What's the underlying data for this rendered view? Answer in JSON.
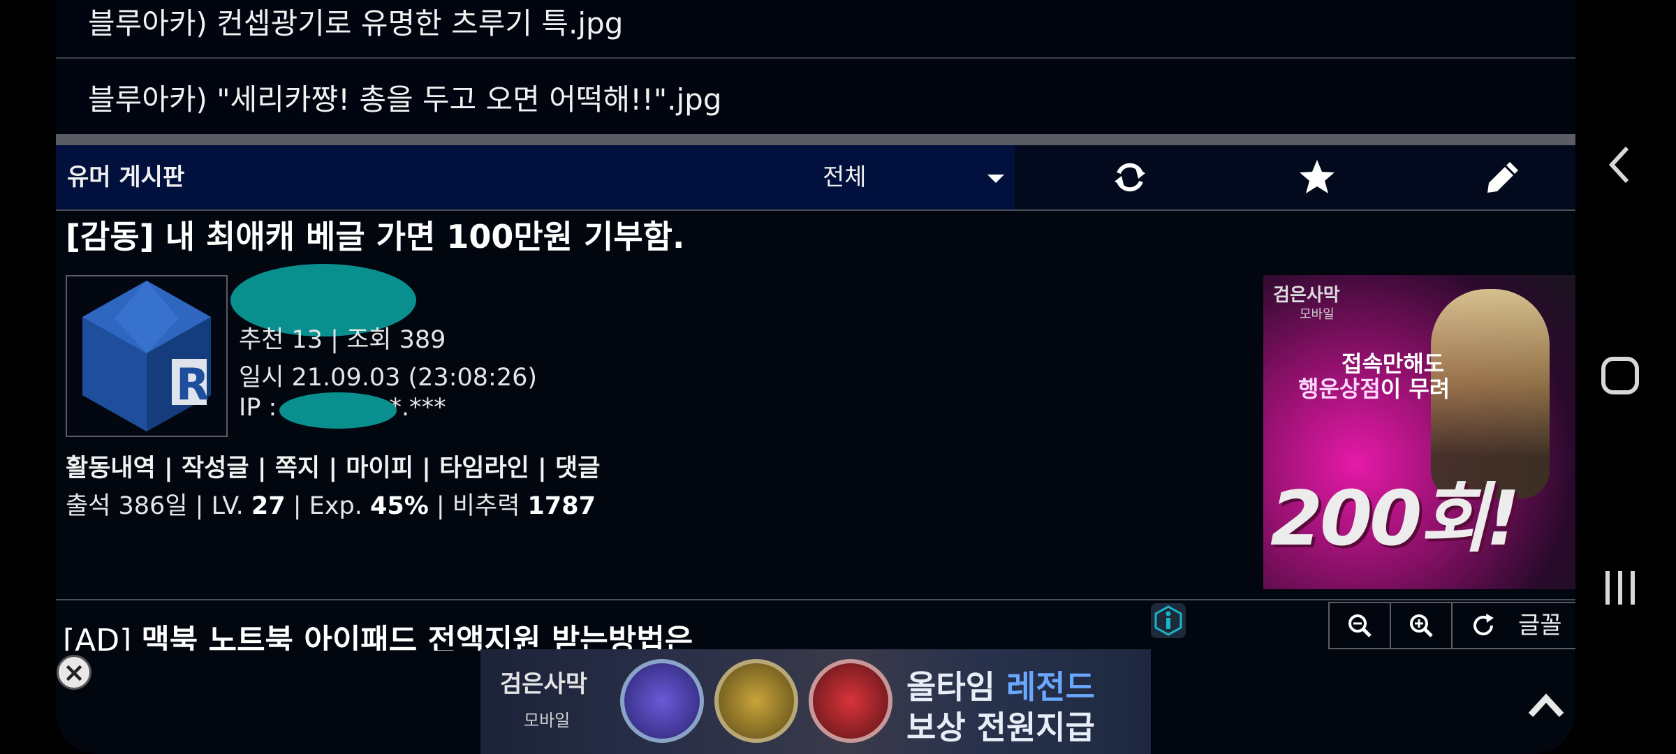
{
  "list": {
    "items": [
      "블루아카) 컨셉광기로 유명한 츠루기 특.jpg",
      "블루아카) \"세리카쨩! 총을 두고 오면 어떡해!!\".jpg"
    ]
  },
  "board": {
    "name": "유머 게시판",
    "filter": "전체",
    "icons": [
      "refresh-icon",
      "star-icon",
      "pencil-icon"
    ]
  },
  "post": {
    "title": "[감동] 내 최애캐 베글 가면 100만원 기부함.",
    "stats": "추천 13 | 조회 389",
    "date": "일시 21.09.03 (23:08:26)",
    "ip_prefix": "IP : ",
    "ip_suffix": "*.***"
  },
  "author_links": {
    "activity": "활동내역",
    "posts": "작성글",
    "message": "쪽지",
    "mypi": "마이피",
    "timeline": "타임라인",
    "comments": "댓글",
    "sep": " | "
  },
  "author_stats": {
    "attendance_label": "출석 386일 |  LV. ",
    "level": "27",
    "exp_label": "  | Exp. ",
    "exp": "45%",
    "power_label": " | 비추력 ",
    "power": "1787"
  },
  "side_ad": {
    "brand": "검은사막",
    "brand_sub": "모바일",
    "line1": "접속만해도",
    "line2_hl": "행운상점",
    "line2_rest": "이 무려",
    "big": "200회!"
  },
  "ad_post": {
    "tag": "[AD] ",
    "title": "맥북 노트북 아이패드 전액지원 받는방법은"
  },
  "toolbar": {
    "icons": [
      "zoom-out-icon",
      "zoom-in-icon",
      "reset-icon"
    ],
    "font_label": "글꼴"
  },
  "bottom_ad": {
    "brand": "검은사막",
    "brand_sub": "모바일",
    "line1_pre": "올타임 ",
    "line1_hl": "레전드",
    "line2": "보상 전원지급"
  },
  "colors": {
    "accent_bar": "#01103c",
    "background": "#02060f",
    "censor": "#0a8f8f"
  }
}
